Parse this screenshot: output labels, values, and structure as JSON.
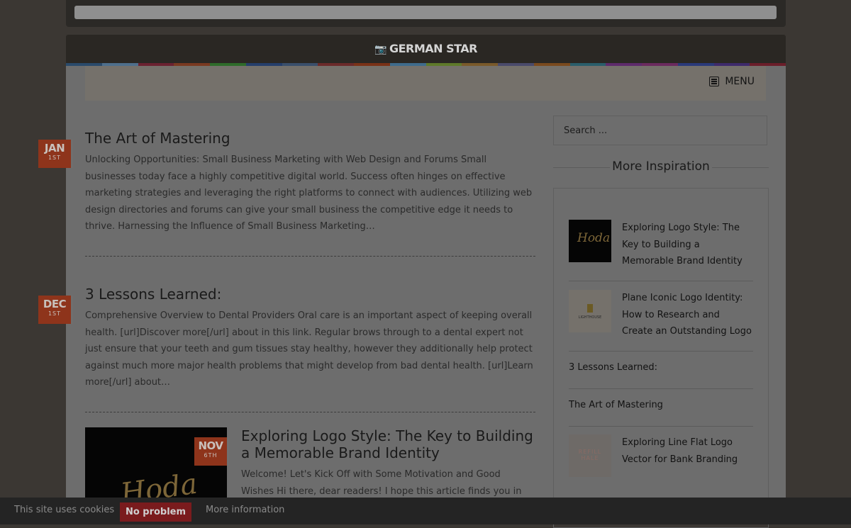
{
  "site": {
    "brand": "GERMAN STAR",
    "brand_icon": "camera-icon"
  },
  "colorbar": [
    "#2a4a6b",
    "#4e6f8c",
    "#6b2231",
    "#7a3a21",
    "#2e6b2a",
    "#253e6b",
    "#3a4f6b",
    "#6b2a2a",
    "#7a3217",
    "#3f6b8c",
    "#5f7a2a",
    "#7a5a2a",
    "#4a4a6b",
    "#7a4a1e",
    "#2a5e6b",
    "#5e2a6b",
    "#6b2a5e",
    "#2a3a7a",
    "#3e2a6b",
    "#6b1e2a"
  ],
  "menu": {
    "label": "MENU",
    "icon": "list-icon"
  },
  "posts": [
    {
      "date": {
        "month": "JAN",
        "day": "1ST"
      },
      "title": "The Art of Mastering",
      "excerpt": "Unlocking Opportunities: Small Business Marketing with Web Design and Forums Small businesses today face a highly competitive digital world. Success often hinges on effective marketing strategies and leveraging the right platforms to connect with audiences. Utilizing web design directories and forums can give your small business the competitive edge it needs to thrive. Harnessing the Influence of Small Business Marketing…"
    },
    {
      "date": {
        "month": "DEC",
        "day": "1ST"
      },
      "title": "3 Lessons Learned:",
      "excerpt": "Comprehensive Overview to Dental Providers Oral care is an important aspect of keeping overall health. [url]Discover more[/url] about in this link. Regular brows through to a dental expert not just ensure that your teeth and gum tissues stay healthy, however they additionally help protect against much more major health problems that might develop from bad dental health. [url]Learn more[/url] about…"
    },
    {
      "date": {
        "month": "NOV",
        "day": "6TH"
      },
      "title": "Exploring Logo Style: The Key to Building a Memorable Brand Identity",
      "excerpt": "Welcome! Let's Kick Off with Some Motivation and Good Wishes Hi there, dear readers! I hope this article finds you in good health and",
      "thumb_text": "Hoda"
    }
  ],
  "sidebar": {
    "search_placeholder": "Search ...",
    "widget_title": "More Inspiration",
    "items": [
      {
        "title": "Exploring Logo Style: The Key to Building a Memorable Brand Identity",
        "thumb_text": "Hoda"
      },
      {
        "title": "Plane Iconic Logo Identity: How to Research and Create an Outstanding Logo",
        "thumb_text": "LIGHTHOUSE"
      },
      {
        "title": "3 Lessons Learned:"
      },
      {
        "title": "The Art of Mastering"
      },
      {
        "title": "Exploring Line Flat Logo Vector for Bank Branding",
        "thumb_text": "REFILL HALE"
      }
    ]
  },
  "cookie": {
    "message": "This site uses cookies",
    "accept": "No problem",
    "more": "More information"
  }
}
